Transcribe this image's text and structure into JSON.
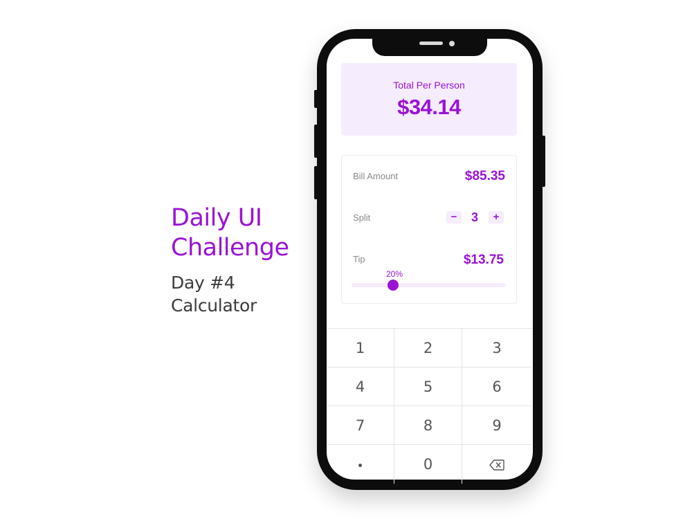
{
  "caption": {
    "title_line1": "Daily UI",
    "title_line2": "Challenge",
    "sub_line1": "Day #4",
    "sub_line2": "Calculator"
  },
  "total": {
    "label": "Total Per Person",
    "value": "$34.14"
  },
  "bill": {
    "label": "Bill Amount",
    "value": "$85.35"
  },
  "split": {
    "label": "Split",
    "minus": "−",
    "plus": "+",
    "value": "3"
  },
  "tip": {
    "label": "Tip",
    "value": "$13.75",
    "percent_label": "20%",
    "slider_fraction": 0.27
  },
  "keypad": {
    "keys": [
      "1",
      "2",
      "3",
      "4",
      "5",
      "6",
      "7",
      "8",
      "9",
      "",
      "0",
      ""
    ],
    "dot_icon": "decimal-dot-icon",
    "backspace_icon": "backspace-icon"
  },
  "colors": {
    "accent": "#9b12d6",
    "accent_light": "#f5ecfd",
    "text_dark": "#3b3b3b"
  }
}
